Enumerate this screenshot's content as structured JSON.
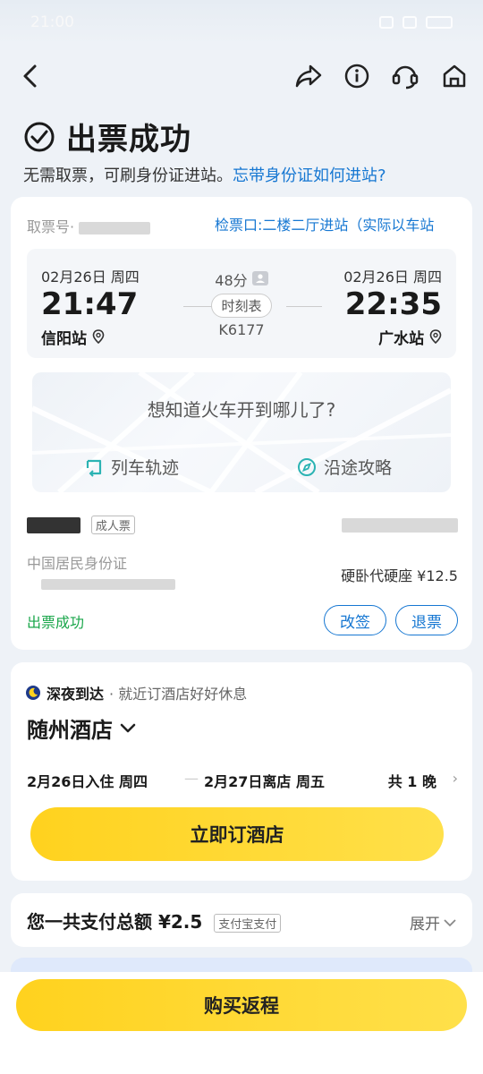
{
  "status_bar": {
    "time": "21:00"
  },
  "header": {
    "title": "出票成功"
  },
  "notice": {
    "text": "无需取票，可刷身份证进站。",
    "link": "忘带身份证如何进站?"
  },
  "ticket": {
    "pickup_label": "取票号·",
    "gate": "检票口:二楼二厅进站（实际以车站",
    "departure": {
      "date": "02月26日 周四",
      "time": "21:47",
      "station": "信阳站"
    },
    "arrival": {
      "date": "02月26日 周四",
      "time": "22:35",
      "station": "广水站"
    },
    "duration": "48分",
    "schedule_label": "时刻表",
    "train_no": "K6177",
    "map": {
      "question": "想知道火车开到哪儿了?",
      "track_label": "列车轨迹",
      "guide_label": "沿途攻略"
    },
    "passenger_type": "成人票",
    "id_type": "中国居民身份证",
    "seat_price": "硬卧代硬座 ¥12.5",
    "status": "出票成功",
    "change_label": "改签",
    "refund_label": "退票"
  },
  "hotel": {
    "night_title": "深夜到达",
    "night_sub": "· 就近订酒店好好休息",
    "city": "随州酒店",
    "checkin": "2月26日入住 周四",
    "dash": "—",
    "checkout": "2月27日离店 周五",
    "nights": "共 1 晚",
    "book_label": "立即订酒店"
  },
  "payment": {
    "label": "您一共支付总额",
    "amount": "¥2.5",
    "method": "支付宝支付",
    "expand_label": "展开"
  },
  "bottom": {
    "return_label": "购买返程"
  },
  "colors": {
    "accent": "#1677d2",
    "success": "#19a64a",
    "cta": "#ffd21e"
  }
}
